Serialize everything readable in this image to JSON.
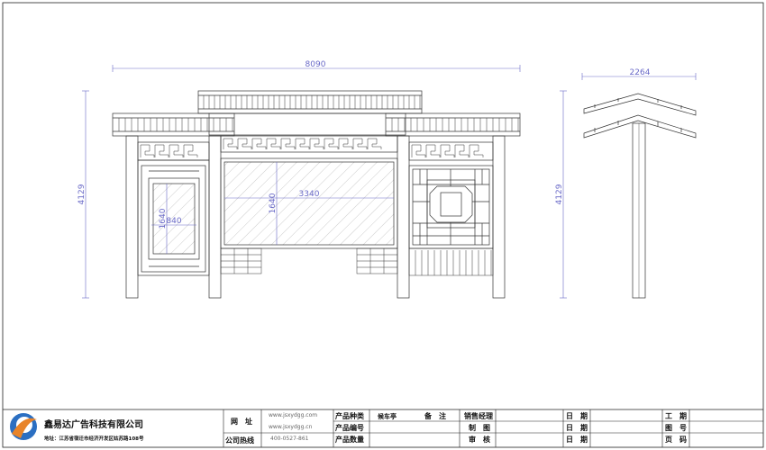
{
  "drawing": {
    "dims": {
      "total_width": "8090",
      "side_width": "2264",
      "height_front": "4129",
      "height_side": "4129",
      "board_width": "3340",
      "board_height": "1640",
      "small_board_height": "1640",
      "small_board_width": "840"
    }
  },
  "title_block": {
    "company": "鑫易达广告科技有限公司",
    "address": "地址：江苏省宿迁市经济开发区姑苏路108号",
    "website_label": "网　址",
    "website_1": "www.jsxydgg.com",
    "website_2": "www.jsxydgg.cn",
    "hotline_label": "公司热线",
    "hotline": "400-0527-861",
    "product_type_label": "产品种类",
    "product_type_value": "候车亭",
    "remark_label": "备　注",
    "product_code_label": "产品编号",
    "product_qty_label": "产品数量",
    "sales_manager_label": "销售经理",
    "drawn_label": "制　图",
    "review_label": "审　核",
    "date_label_1": "日　期",
    "date_label_2": "日　期",
    "date_label_3": "日　期",
    "job_no_label": "工　期",
    "drawing_no_label": "图　号",
    "page_no_label": "页　码"
  }
}
